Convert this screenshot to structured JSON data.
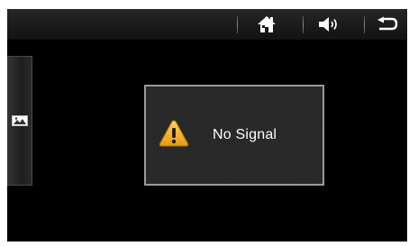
{
  "dialog": {
    "message": "No Signal",
    "icon": "warning-icon"
  },
  "toolbar": {
    "buttons": [
      {
        "name": "home",
        "icon": "home-icon"
      },
      {
        "name": "volume",
        "icon": "speaker-icon"
      },
      {
        "name": "back",
        "icon": "back-arrow-icon"
      }
    ]
  },
  "side_panel": {
    "icon": "picture-icon"
  },
  "colors": {
    "background": "#000000",
    "toolbar": "#1c1c1c",
    "dialog_border": "#9a9a9a",
    "warning": "#f2b21c",
    "text": "#ffffff"
  }
}
